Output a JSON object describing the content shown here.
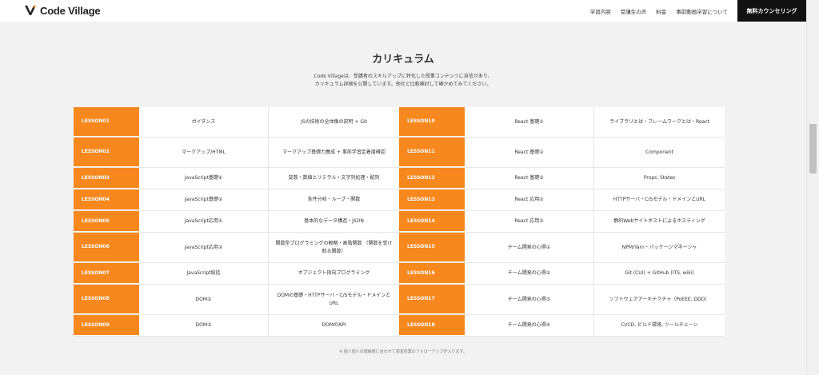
{
  "header": {
    "logo_text": "Code Village",
    "nav": [
      "学習内容",
      "受講生の声",
      "料金",
      "事前動画学習について"
    ],
    "cta": "無料カウンセリング"
  },
  "section": {
    "title": "カリキュラム",
    "lead_line1": "Code Villageは、受講者のスキルアップに特化した授業コンテンツに自信があり、",
    "lead_line2": "カリキュラム詳細を公開しています。他社と比較検討して確かめてみてください。"
  },
  "left": [
    {
      "lesson": "LESSON01",
      "topic": "ガイダンス",
      "detail": "JSの技術の全体像の説明 + Git"
    },
    {
      "lesson": "LESSON02",
      "topic": "マークアップ/HTML",
      "detail": "マークアップ基礎力養成 + 事前学習定着度確認"
    },
    {
      "lesson": "LESSON03",
      "topic": "JavaScript基礎①",
      "detail": "変数・数値とリテラル・文字列処理・配列"
    },
    {
      "lesson": "LESSON04",
      "topic": "JavaScript基礎②",
      "detail": "条件分岐・ループ・関数"
    },
    {
      "lesson": "LESSON05",
      "topic": "JavaScript応用①",
      "detail": "基本的なデータ構造・JSON"
    },
    {
      "lesson": "LESSON06",
      "topic": "JavaScript応用②",
      "detail": "関数型プログラミングの概略・高階関数 （関数を受け取る関数）"
    },
    {
      "lesson": "LESSON07",
      "topic": "JavaScript総括",
      "detail": "オブジェクト指向プログラミング"
    },
    {
      "lesson": "LESSON08",
      "topic": "DOM①",
      "detail": "DOMの基礎・HTTPサーバ・C/Sモデル・ドメインとURL"
    },
    {
      "lesson": "LESSON09",
      "topic": "DOM②",
      "detail": "DOMのAPI"
    }
  ],
  "right": [
    {
      "lesson": "LESSON10",
      "topic": "React 基礎①",
      "detail": "ライブラリとは・フレームワークとは・React"
    },
    {
      "lesson": "LESSON11",
      "topic": "React 基礎②",
      "detail": "Component"
    },
    {
      "lesson": "LESSON12",
      "topic": "React 基礎③",
      "detail": "Props, States"
    },
    {
      "lesson": "LESSON13",
      "topic": "React 応用①",
      "detail": "HTTPサーバ・C/Sモデル・ドメインとURL"
    },
    {
      "lesson": "LESSON14",
      "topic": "React 応用②",
      "detail": "静的Webサイトホストによるホスティング"
    },
    {
      "lesson": "LESSON15",
      "topic": "チーム開発の心得①",
      "detail": "NPM/Yarn・パッケージマネージャ"
    },
    {
      "lesson": "LESSON16",
      "topic": "チーム開発の心得②",
      "detail": "Git (CUI) + GitHub (ITS, wiki)"
    },
    {
      "lesson": "LESSON17",
      "topic": "チーム開発の心得③",
      "detail": "ソフトウェアアーキテクチャ（PoEEE, DDD）"
    },
    {
      "lesson": "LESSON18",
      "topic": "チーム開発の心得④",
      "detail": "CI/CD, ビルド環境, ツールチェーン"
    }
  ],
  "footnote": "※ 個人個人の理解度に合わせて適宜授業のフォローアップが入ります。",
  "colors": {
    "accent": "#f7881e",
    "cta_bg": "#111111"
  }
}
